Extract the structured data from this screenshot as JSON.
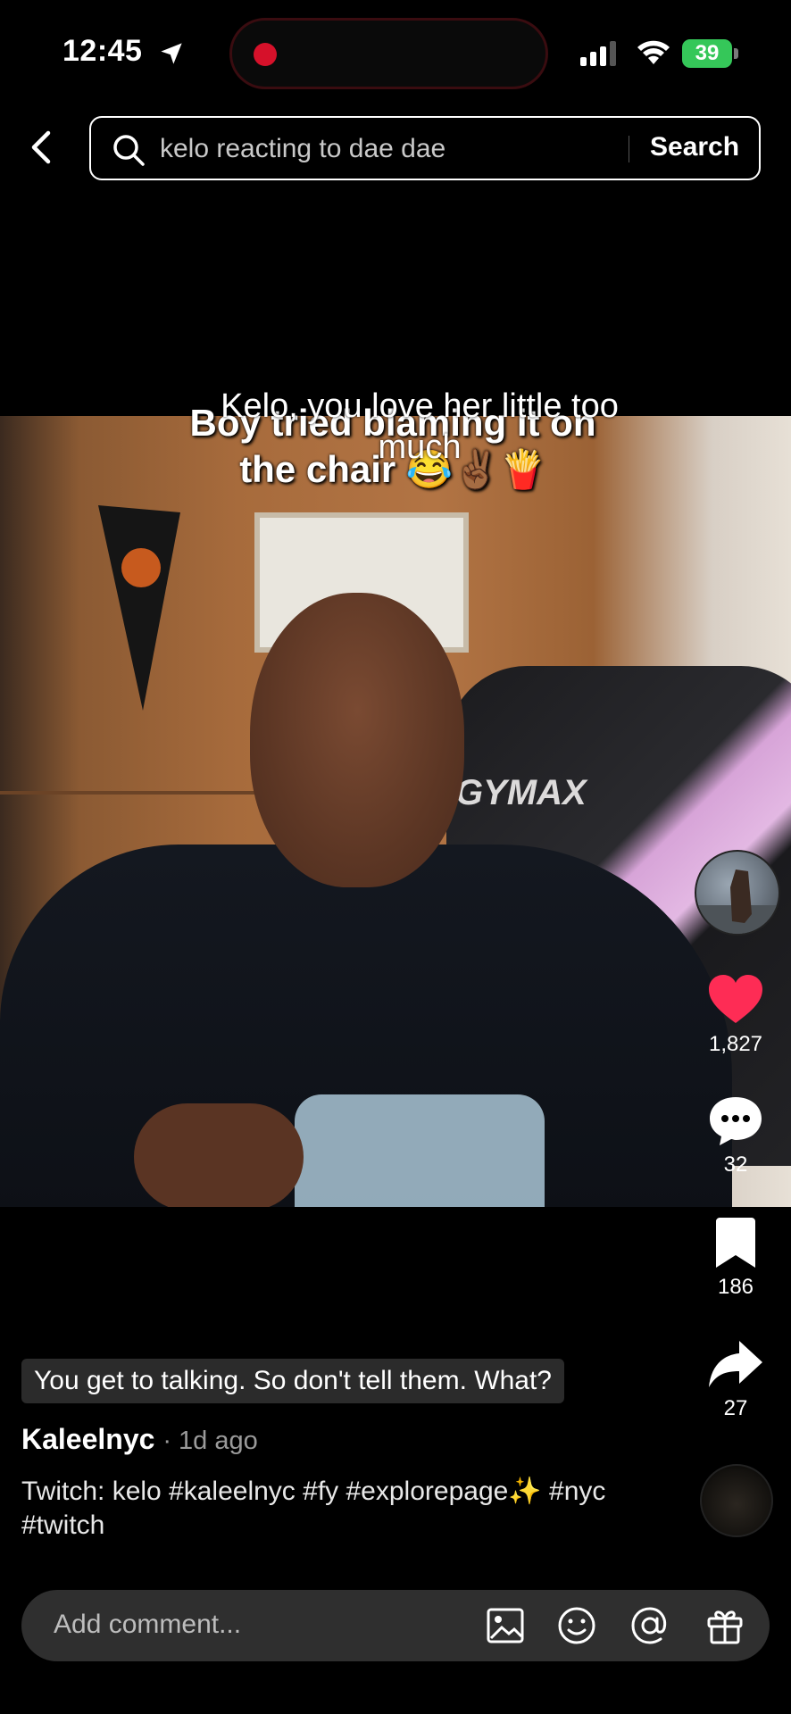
{
  "status_bar": {
    "time": "12:45",
    "battery": "39"
  },
  "search": {
    "query": "kelo reacting to dae dae",
    "button_label": "Search"
  },
  "video": {
    "caption_in_video_line1": "Boy tried blaming it on",
    "caption_in_video_line2": "the chair 😂✌🏾🍟",
    "chair_brand": "GYMAX",
    "overlay_caption_line1": "Kelo, you love her little too",
    "overlay_caption_line2": "much"
  },
  "rail": {
    "likes": "1,827",
    "comments": "32",
    "saves": "186",
    "shares": "27",
    "like_color": "#fe2c55"
  },
  "post": {
    "subtitle_chip": "You get to talking. So don't tell them. What?",
    "username": "Kaleelnyc",
    "time_ago": "· 1d ago",
    "description": "Twitch: kelo #kaleelnyc #fy #explorepage✨ #nyc #twitch"
  },
  "comment_bar": {
    "placeholder": "Add comment..."
  }
}
